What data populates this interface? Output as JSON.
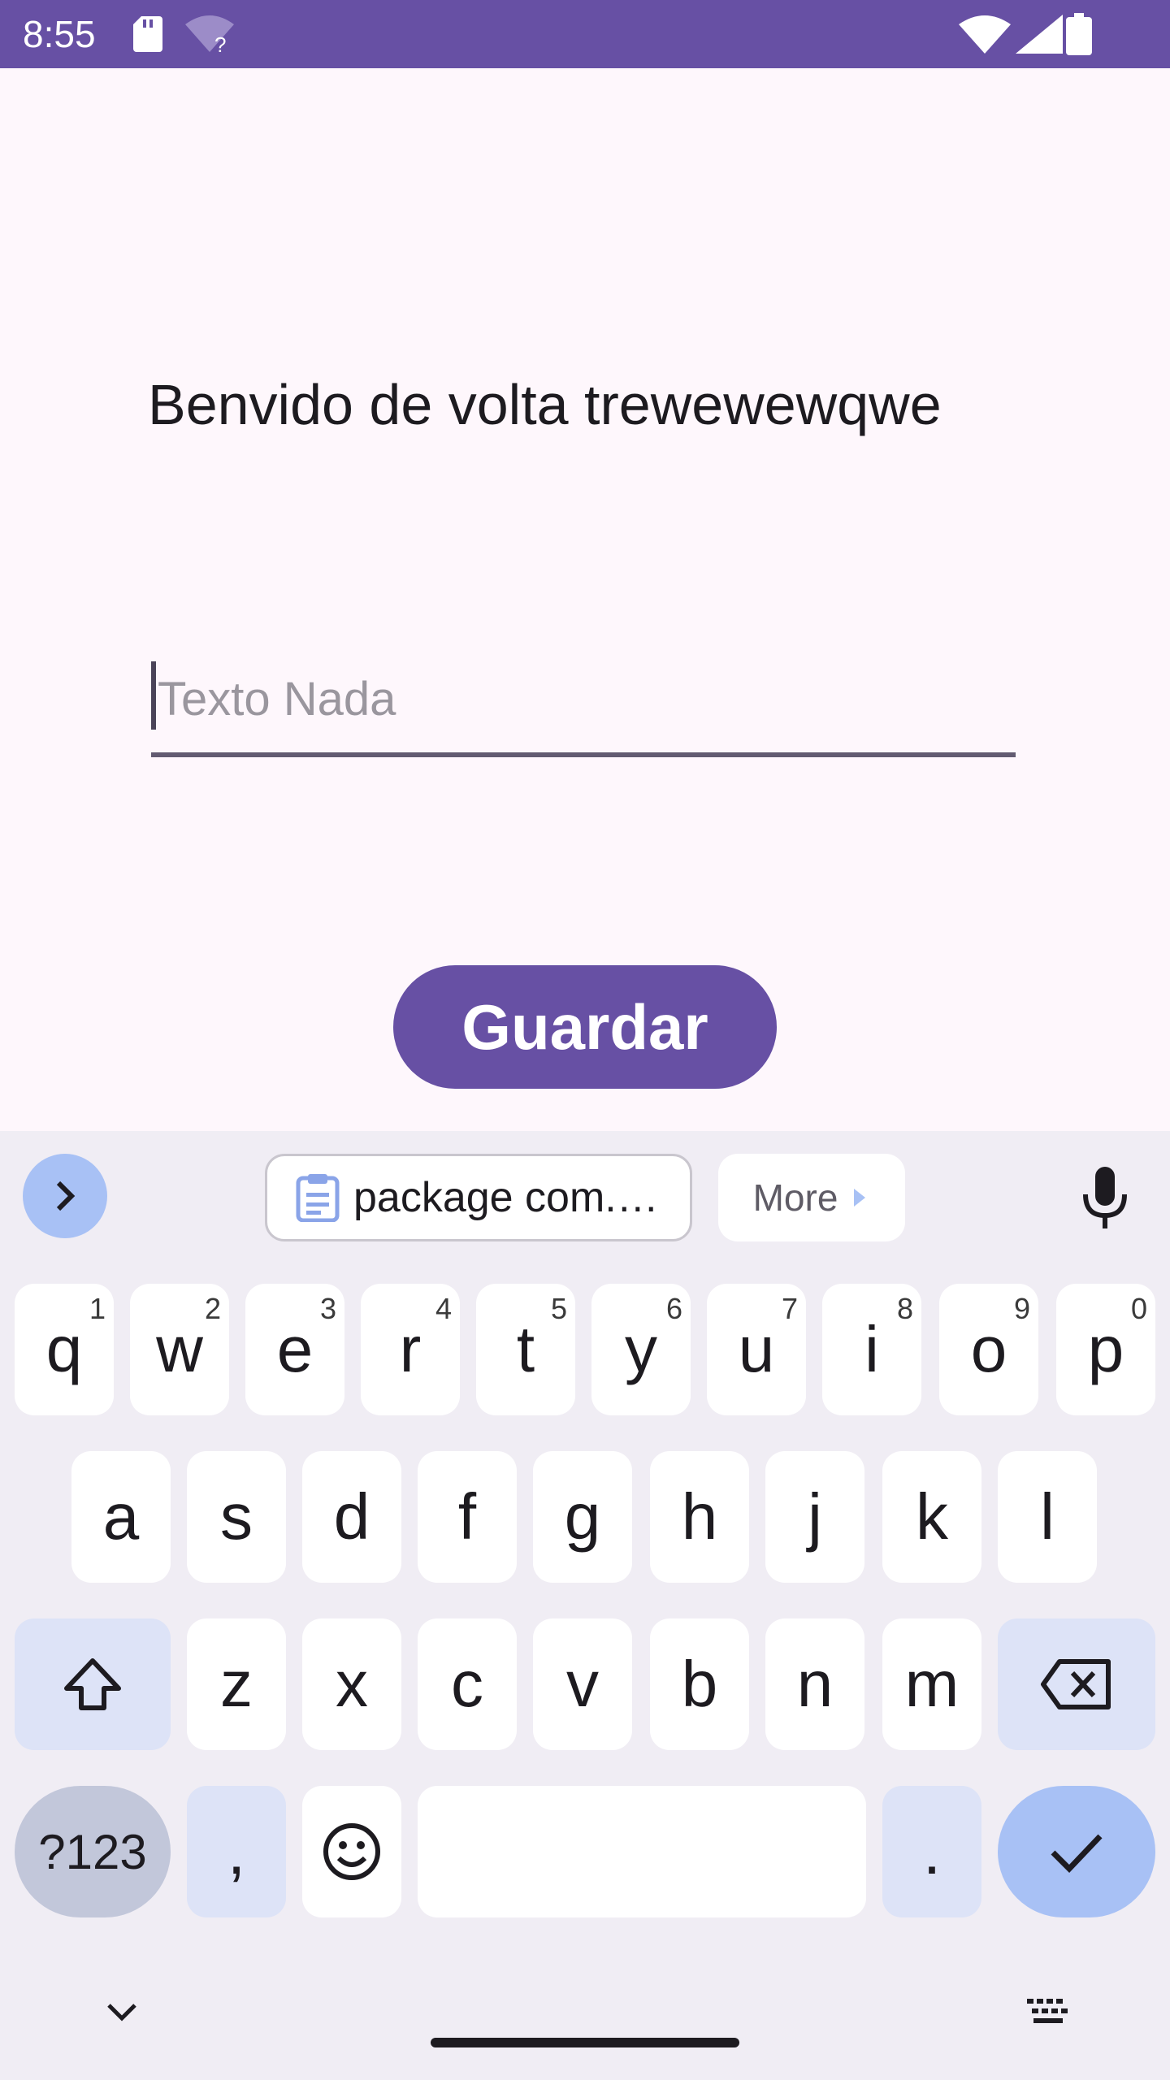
{
  "status_bar": {
    "time": "8:55"
  },
  "main": {
    "welcome_text": "Benvido de volta trewewewqwe",
    "text_field": {
      "placeholder": "Texto Nada",
      "value": ""
    },
    "save_button": "Guardar"
  },
  "keyboard": {
    "suggestions": {
      "clipboard_chip": "package com.…",
      "more_chip": "More"
    },
    "row1": [
      {
        "label": "q",
        "hint": "1"
      },
      {
        "label": "w",
        "hint": "2"
      },
      {
        "label": "e",
        "hint": "3"
      },
      {
        "label": "r",
        "hint": "4"
      },
      {
        "label": "t",
        "hint": "5"
      },
      {
        "label": "y",
        "hint": "6"
      },
      {
        "label": "u",
        "hint": "7"
      },
      {
        "label": "i",
        "hint": "8"
      },
      {
        "label": "o",
        "hint": "9"
      },
      {
        "label": "p",
        "hint": "0"
      }
    ],
    "row2": [
      "a",
      "s",
      "d",
      "f",
      "g",
      "h",
      "j",
      "k",
      "l"
    ],
    "row3": [
      "z",
      "x",
      "c",
      "v",
      "b",
      "n",
      "m"
    ],
    "row4": {
      "numbers": "?123",
      "comma": ",",
      "period": "."
    }
  },
  "colors": {
    "primary": "#6750A4",
    "background": "#FEF7FC",
    "keyboard_bg": "#F0EDF4"
  }
}
